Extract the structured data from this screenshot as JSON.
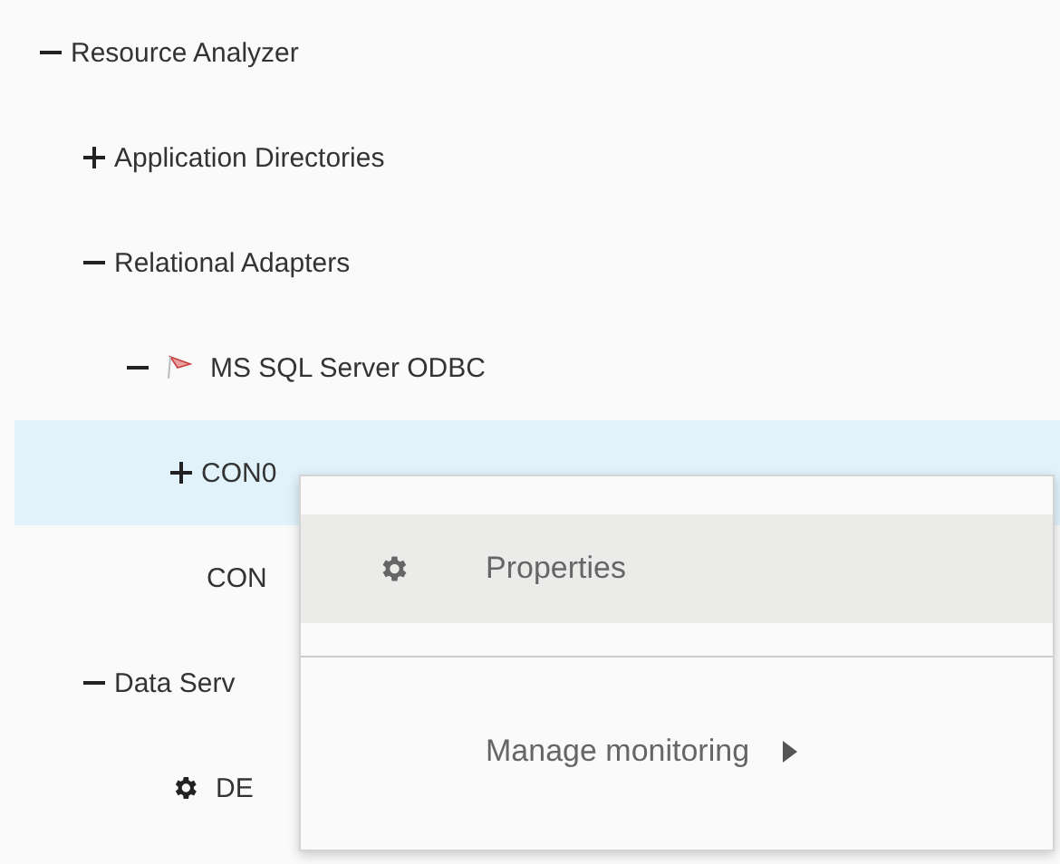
{
  "tree": [
    {
      "label": "Resource Analyzer",
      "expanded": true,
      "selected": false,
      "children": [
        {
          "label": "Application Directories",
          "expanded": false,
          "selected": false
        },
        {
          "label": "Relational Adapters",
          "expanded": true,
          "selected": false,
          "children": [
            {
              "label": "MS SQL Server ODBC",
              "kind": "flag",
              "expanded": true,
              "selected": false,
              "children": [
                {
                  "label": "CON0",
                  "expanded": false,
                  "selected": true
                },
                {
                  "label": "CON",
                  "selected": false
                }
              ]
            }
          ]
        },
        {
          "label": "Data Serv",
          "expanded": true,
          "selected": false,
          "children": [
            {
              "label": "DE",
              "kind": "gear",
              "selected": false
            }
          ]
        }
      ]
    }
  ],
  "context_menu": {
    "items": [
      {
        "label": "Properties",
        "kind": "gear",
        "selected": true,
        "submenu": false
      },
      {
        "label": "Manage monitoring",
        "selected": false,
        "submenu": true
      }
    ]
  }
}
